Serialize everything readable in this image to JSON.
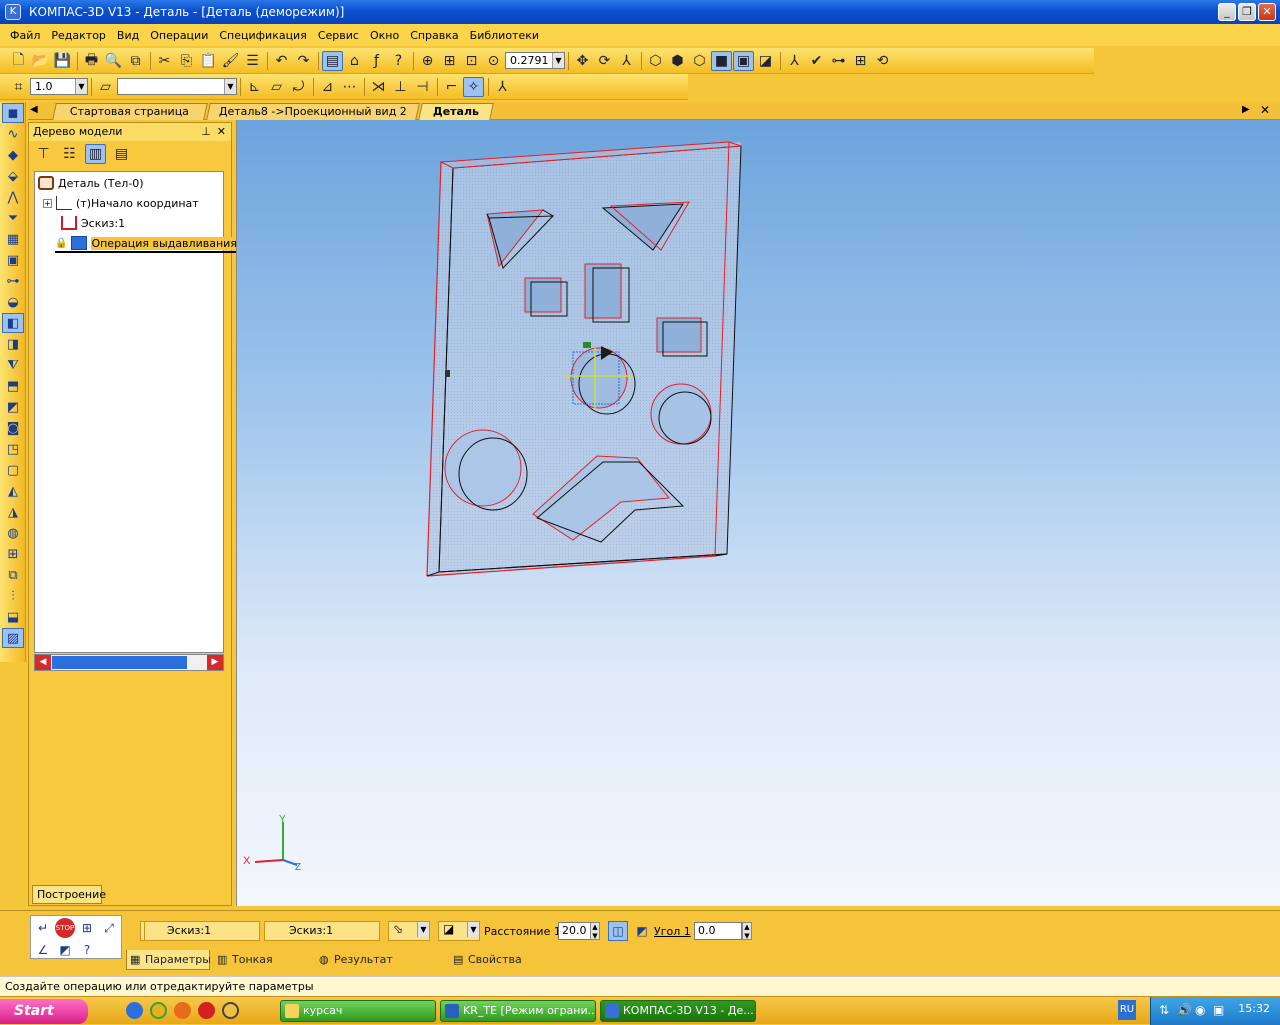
{
  "window": {
    "title": "КОМПАС-3D V13 - Деталь - [Деталь (деморежим)]",
    "buttons": [
      "minimize-icon",
      "restore-icon",
      "close-icon"
    ]
  },
  "menu": [
    "Файл",
    "Редактор",
    "Вид",
    "Операции",
    "Спецификация",
    "Сервис",
    "Окно",
    "Справка",
    "Библиотеки"
  ],
  "toolbar1": {
    "zoom_value": "0.2791"
  },
  "toolbar2": {
    "step_value": "1.0",
    "line_combo": ""
  },
  "tabs": [
    {
      "label": "Стартовая страница",
      "active": false
    },
    {
      "label": "Деталь8 ->Проекционный вид 2",
      "active": false
    },
    {
      "label": "Деталь",
      "active": true
    }
  ],
  "tree": {
    "title": "Дерево модели",
    "nodes": [
      {
        "label": "Деталь (Тел-0)"
      },
      {
        "label": "(т)Начало координат"
      },
      {
        "label": "Эскиз:1"
      },
      {
        "label": "Операция выдавливания"
      }
    ],
    "bottom_tab": "Построение"
  },
  "axes": {
    "x": "X",
    "y": "Y",
    "z": "Z"
  },
  "properties": {
    "sketch1": "Эскиз:1",
    "sketch2": "Эскиз:1",
    "distance_label": "Расстояние 1",
    "distance_value": "20.0",
    "angle_label": "Угол 1",
    "angle_value": "0.0",
    "tabs": [
      "Параметры",
      "Тонкая стенка",
      "Результат операции",
      "Свойства"
    ]
  },
  "status": "Создайте операцию или отредактируйте параметры",
  "taskbar": {
    "start": "Start",
    "buttons": [
      "курсач",
      "KR_TE [Режим ограни...",
      "КОМПАС-3D V13 - Де..."
    ],
    "lang": "RU",
    "clock": "15:32"
  },
  "colors": {
    "title_bar": "#0a4fd0",
    "panel_yellow": "#f6c43a",
    "edge_red": "#e0202a",
    "edge_black": "#101010",
    "taskbar_green": "#2f9a1e",
    "start_pink": "#d81f8a"
  }
}
